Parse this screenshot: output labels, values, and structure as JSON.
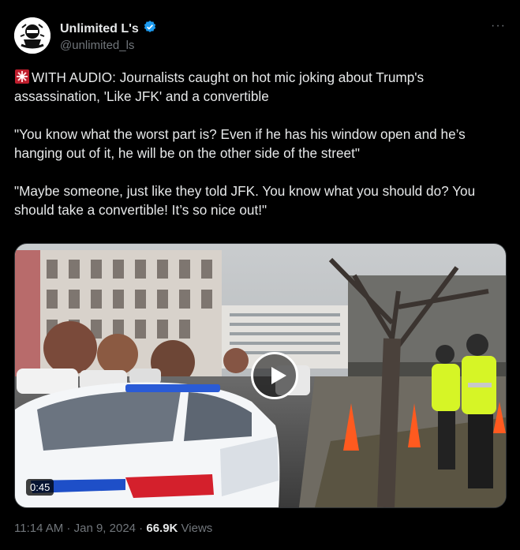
{
  "author": {
    "name": "Unlimited L's",
    "handle": "@unlimited_ls",
    "verified": true,
    "verified_color": "#1d9bf0"
  },
  "menu_icon": "more-horizontal-icon",
  "tweet": {
    "p1": "WITH AUDIO: Journalists caught on hot mic joking about Trump's assassination, 'Like JFK' and a convertible",
    "p2": "\"You  know what the worst part is? Even if he has his window open and he’s hanging out of it, he will be on the other side of the street\"",
    "p3": "\"Maybe someone, just like they told JFK. You know what you should do? You should take a convertible! It’s so nice out!\""
  },
  "media": {
    "duration": "0:45"
  },
  "meta": {
    "time": "11:14 AM",
    "separator": " · ",
    "date": "Jan 9, 2024",
    "views_count": "66.9K",
    "views_label": " Views"
  }
}
